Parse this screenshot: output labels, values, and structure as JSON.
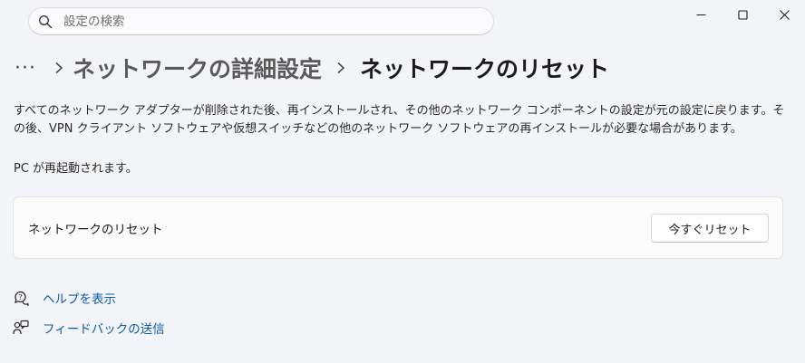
{
  "search": {
    "placeholder": "設定の検索"
  },
  "breadcrumb": {
    "more": "···",
    "parent": "ネットワークの詳細設定",
    "current": "ネットワークのリセット"
  },
  "description": "すべてのネットワーク アダプターが削除された後、再インストールされ、その他のネットワーク コンポーネントの設定が元の設定に戻ります。その後、VPN クライアント ソフトウェアや仮想スイッチなどの他のネットワーク ソフトウェアの再インストールが必要な場合があります。",
  "note": "PC が再起動されます。",
  "card": {
    "label": "ネットワークのリセット",
    "button_label": "今すぐリセット"
  },
  "links": {
    "help": "ヘルプを表示",
    "feedback": "フィードバックの送信"
  },
  "colors": {
    "link": "#0b5cad",
    "background": "#f3f4f8"
  },
  "icons": [
    "search-icon",
    "minimize-icon",
    "maximize-icon",
    "close-icon",
    "chevron-right-icon",
    "help-icon",
    "feedback-icon"
  ]
}
